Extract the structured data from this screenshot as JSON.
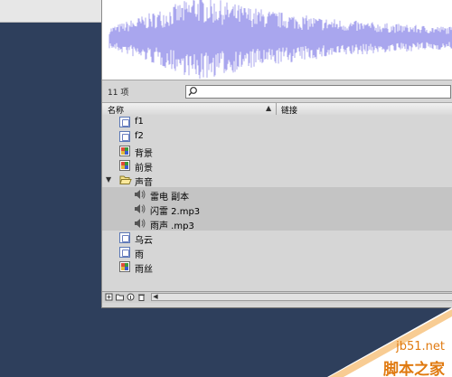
{
  "library": {
    "item_count": "11 项",
    "search": {
      "value": "",
      "placeholder": ""
    },
    "columns": {
      "name": "名称",
      "link": "链接"
    },
    "items": [
      {
        "label": "f1",
        "icon": "graphic-symbol-icon",
        "indent": 1
      },
      {
        "label": "f2",
        "icon": "graphic-symbol-icon",
        "indent": 1
      },
      {
        "label": "背景",
        "icon": "bitmap-icon",
        "indent": 1
      },
      {
        "label": "前景",
        "icon": "bitmap-icon",
        "indent": 1
      },
      {
        "label": "声音",
        "icon": "folder-open-icon",
        "indent": 0,
        "expanded": true
      },
      {
        "label": "雷电 副本",
        "icon": "sound-icon",
        "indent": 2,
        "selected": true
      },
      {
        "label": "闪雷 2.mp3",
        "icon": "sound-icon",
        "indent": 2,
        "selected": true
      },
      {
        "label": "雨声 .mp3",
        "icon": "sound-icon",
        "indent": 2,
        "selected": true
      },
      {
        "label": "乌云",
        "icon": "graphic-symbol-icon",
        "indent": 1
      },
      {
        "label": "雨",
        "icon": "graphic-symbol-icon",
        "indent": 1
      },
      {
        "label": "雨丝",
        "icon": "bitmap-icon",
        "indent": 1
      }
    ],
    "bottom_toolbar": [
      "new-symbol-icon",
      "new-folder-icon",
      "properties-icon",
      "delete-icon"
    ]
  },
  "colors": {
    "waveform": "#a9a6ee",
    "background": "#2e3f5c",
    "panel": "#d6d6d6",
    "watermark": "#e07a10"
  },
  "watermark": {
    "site": "jb51.net",
    "name": "脚本之家"
  }
}
